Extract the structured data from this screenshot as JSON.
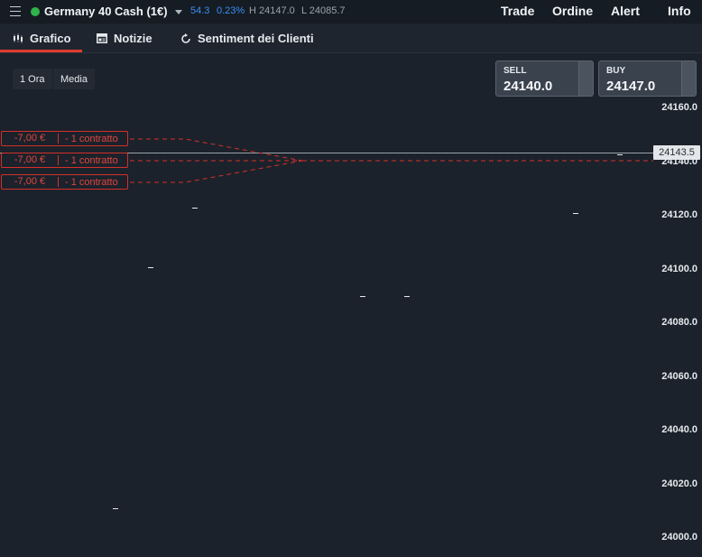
{
  "header": {
    "instrument": "Germany 40 Cash (1€)",
    "change_points": "54.3",
    "change_percent": "0.23%",
    "high": "H 24147.0",
    "low": "L 24085.7",
    "nav": [
      "Trade",
      "Ordine",
      "Alert",
      "Info"
    ],
    "status_color": "#2fb34a"
  },
  "tabs": [
    {
      "label": "Grafico",
      "icon": "candlestick-icon",
      "active": true
    },
    {
      "label": "Notizie",
      "icon": "newspaper-icon",
      "active": false
    },
    {
      "label": "Sentiment dei Clienti",
      "icon": "refresh-icon",
      "active": false
    }
  ],
  "toolbar": {
    "timeframe": "1 Ora",
    "indicator": "Media"
  },
  "quote": {
    "sell_label": "SELL",
    "sell_price": "24140.0",
    "buy_label": "BUY",
    "buy_price": "24147.0"
  },
  "current_price": "24143.5",
  "positions": [
    {
      "pnl": "-7,00 €",
      "qty": "- 1 contratto"
    },
    {
      "pnl": "-7,00 €",
      "qty": "- 1 contratto"
    },
    {
      "pnl": "-7,00 €",
      "qty": "- 1 contratto"
    }
  ],
  "chart_data": {
    "type": "line",
    "y_ticks": [
      "24160.0",
      "24140.0",
      "24120.0",
      "24100.0",
      "24080.0",
      "24060.0",
      "24040.0",
      "24020.0",
      "24000.0"
    ],
    "ylim": [
      24000,
      24160
    ],
    "markers": [
      24123,
      24101,
      24090,
      24090,
      24121,
      24143,
      24011
    ],
    "accent_color": "#e03b2f",
    "loss_color": "#d4302a"
  }
}
